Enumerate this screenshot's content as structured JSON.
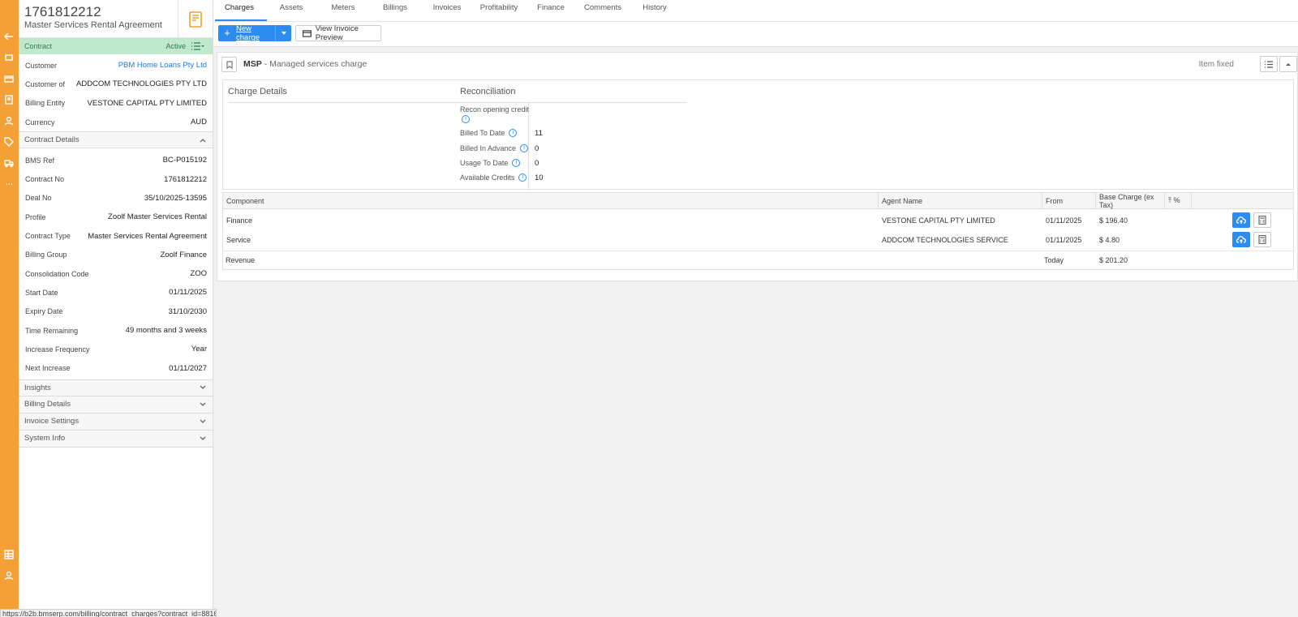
{
  "contract": {
    "id": "1761812212",
    "name": "Master Services Rental Agreement",
    "bar_label": "Contract",
    "status": "Active"
  },
  "summary": [
    {
      "label": "Customer",
      "value": "PBM Home Loans Pty Ltd",
      "link": true
    },
    {
      "label": "Customer of",
      "value": "ADDCOM TECHNOLOGIES PTY LTD"
    },
    {
      "label": "Billing Entity",
      "value": "VESTONE CAPITAL PTY LIMITED"
    },
    {
      "label": "Currency",
      "value": "AUD"
    }
  ],
  "contract_details": {
    "title": "Contract Details",
    "rows": [
      {
        "label": "BMS Ref",
        "value": "BC-P015192"
      },
      {
        "label": "Contract No",
        "value": "1761812212"
      },
      {
        "label": "Deal No",
        "value": "35/10/2025-13595"
      },
      {
        "label": "Profile",
        "value": "Zoolf Master Services Rental"
      },
      {
        "label": "Contract Type",
        "value": "Master Services Rental Agreement"
      },
      {
        "label": "Billing Group",
        "value": "Zoolf Finance"
      },
      {
        "label": "Consolidation Code",
        "value": "ZOO"
      },
      {
        "label": "Start Date",
        "value": "01/11/2025"
      },
      {
        "label": "Expiry Date",
        "value": "31/10/2030"
      },
      {
        "label": "Time Remaining",
        "value": "49 months and 3 weeks"
      },
      {
        "label": "Increase Frequency",
        "value": "Year"
      },
      {
        "label": "Next Increase",
        "value": "01/11/2027"
      }
    ]
  },
  "collapsed_sections": [
    "Insights",
    "Billing Details",
    "Invoice Settings",
    "System Info"
  ],
  "tabs": [
    "Charges",
    "Assets",
    "Meters",
    "Billings",
    "Invoices",
    "Profitability",
    "Finance",
    "Comments",
    "History"
  ],
  "toolbar": {
    "new_charge": "New charge",
    "view_invoice_preview": "View Invoice Preview"
  },
  "charge": {
    "code": "MSP",
    "title": " - Managed services charge",
    "item_fixed": "Item fixed",
    "charge_details_title": "Charge Details",
    "reconciliation_title": "Reconciliation",
    "recon": [
      {
        "label": "Recon opening credit",
        "value": ""
      },
      {
        "label": "Billed To Date",
        "value": "11"
      },
      {
        "label": "Billed In Advance",
        "value": "0"
      },
      {
        "label": "Usage To Date",
        "value": "0"
      },
      {
        "label": "Available Credits",
        "value": "10"
      }
    ]
  },
  "components": {
    "headers": [
      "Component",
      "Agent Name",
      "From",
      "Base Charge (ex Tax)",
      "⤒ %"
    ],
    "rows": [
      {
        "component": "Finance",
        "agent": "VESTONE CAPITAL PTY LIMITED",
        "from": "01/11/2025",
        "base": "$ 196.40"
      },
      {
        "component": "Service",
        "agent": "ADDCOM TECHNOLOGIES SERVICE",
        "from": "01/11/2025",
        "base": "$ 4.80"
      }
    ],
    "revenue": {
      "label": "Revenue",
      "from": "Today",
      "base": "$ 201.20"
    }
  },
  "status_url": "https://b2b.bmserp.com/billing/contract_charges?contract_id=8816",
  "colors": {
    "rail": "#f5a034",
    "accent": "#2d8cf0",
    "active_bar": "#bfe8cd",
    "link": "#1e7ad6"
  }
}
